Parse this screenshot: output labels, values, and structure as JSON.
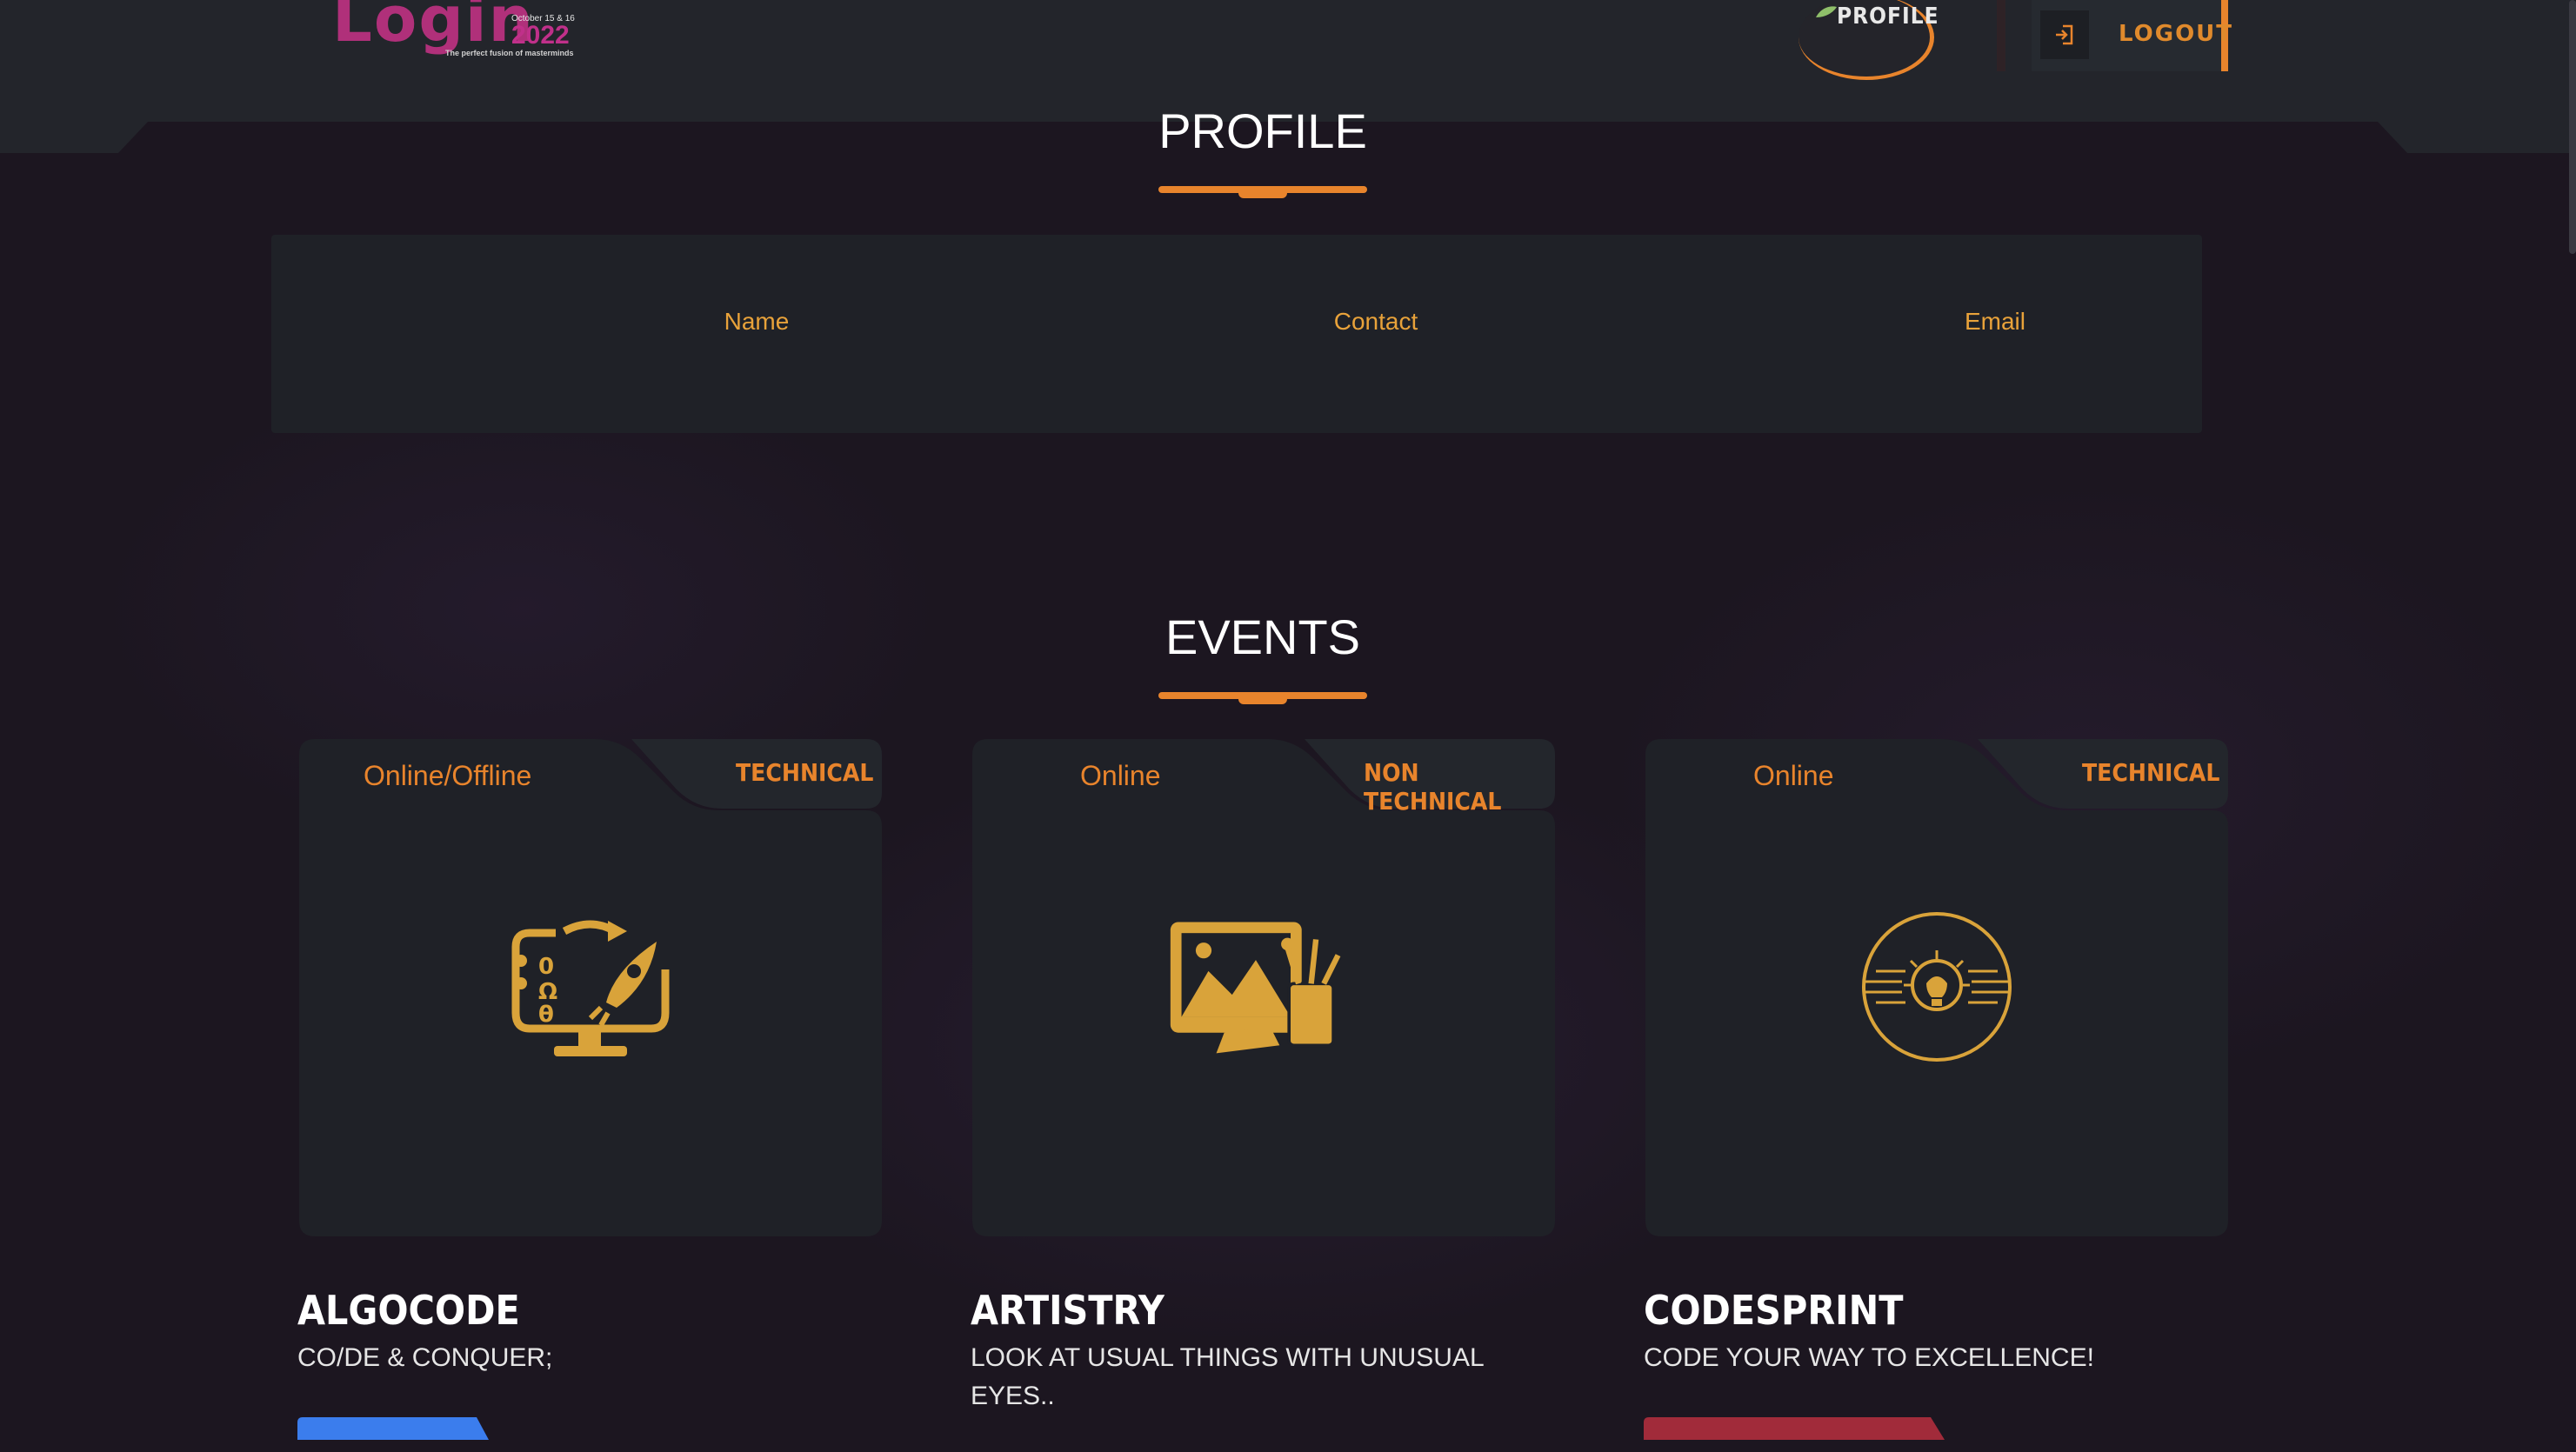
{
  "header": {
    "logo": {
      "word": "Login",
      "year": "2022",
      "dates": "October 15 & 16",
      "tagline": "The perfect fusion of masterminds"
    },
    "profile_label": "PROFILE",
    "logout_label": "LOGOUT"
  },
  "profile_section": {
    "title": "PROFILE",
    "columns": [
      "Name",
      "Contact",
      "Email"
    ]
  },
  "events_section": {
    "title": "EVENTS",
    "events": [
      {
        "mode": "Online/Offline",
        "category": "TECHNICAL",
        "name": "ALGOCODE",
        "tagline": "CO/DE & CONQUER;",
        "icon": "code-rocket-icon",
        "button_color": "#3b7ded"
      },
      {
        "mode": "Online",
        "category": "NON TECHNICAL",
        "name": "ARTISTRY",
        "tagline": "LOOK AT USUAL THINGS WITH UNUSUAL EYES..",
        "icon": "art-monitor-icon",
        "button_color": "#a12b3a"
      },
      {
        "mode": "Online",
        "category": "TECHNICAL",
        "name": "CODESPRINT",
        "tagline": "CODE YOUR WAY TO EXCELLENCE!",
        "icon": "lightbulb-speed-icon",
        "button_color": "#a12b3a"
      }
    ]
  },
  "colors": {
    "accent": "#e8842c",
    "icon_gold": "#d9a33a",
    "card_bg": "#1f2127",
    "page_bg": "#1c1620"
  }
}
